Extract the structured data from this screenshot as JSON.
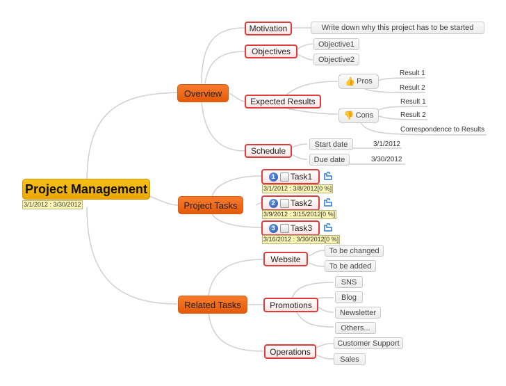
{
  "root": {
    "label": "Project Management",
    "dates": "3/1/2012 : 3/30/2012"
  },
  "overview": {
    "label": "Overview",
    "motivation": {
      "label": "Motivation",
      "note": "Write down why this project has to be started"
    },
    "objectives": {
      "label": "Objectives",
      "items": [
        "Objective1",
        "Objective2"
      ]
    },
    "expected_results": {
      "label": "Expected Results",
      "pros": {
        "label": "Pros",
        "icon": "thumbs-up-icon",
        "items": [
          "Result 1",
          "Result 2"
        ]
      },
      "cons": {
        "label": "Cons",
        "icon": "thumbs-down-icon",
        "items": [
          "Result 1",
          "Result 2",
          "Correspondence to Results"
        ]
      }
    },
    "schedule": {
      "label": "Schedule",
      "start": {
        "label": "Start date",
        "value": "3/1/2012"
      },
      "due": {
        "label": "Due date",
        "value": "3/30/2012"
      }
    }
  },
  "project_tasks": {
    "label": "Project Tasks",
    "tasks": [
      {
        "num": "1",
        "label": "Task1",
        "dates": "3/1/2012 : 3/8/2012[0 %]",
        "progress": 0
      },
      {
        "num": "2",
        "label": "Task2",
        "dates": "3/9/2012 : 3/15/2012[0 %]",
        "progress": 0
      },
      {
        "num": "3",
        "label": "Task3",
        "dates": "3/16/2012 : 3/30/2012[0 %]",
        "progress": 0
      }
    ]
  },
  "related_tasks": {
    "label": "Related Tasks",
    "website": {
      "label": "Website",
      "items": [
        "To be changed",
        "To be added"
      ]
    },
    "promotions": {
      "label": "Promotions",
      "items": [
        "SNS",
        "Blog",
        "Newsletter",
        "Others..."
      ]
    },
    "operations": {
      "label": "Operations",
      "items": [
        "Customer Support",
        "Sales"
      ]
    }
  },
  "colors": {
    "root": "#f0b400",
    "main": "#f06a1a",
    "sub_border": "#e03a3a",
    "link": "#cfcfcf"
  }
}
